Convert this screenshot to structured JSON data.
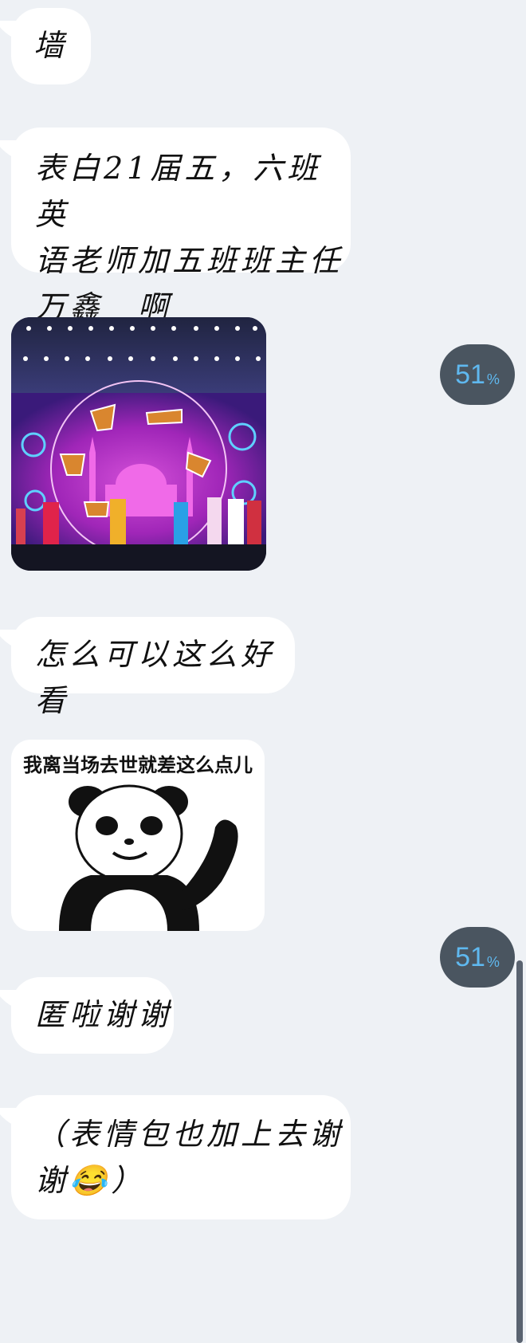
{
  "messages": [
    {
      "text": "墙"
    },
    {
      "text_lines": [
        "表白21届五，六班英",
        "语老师加五班班主任",
        "万鑫　啊"
      ]
    },
    {
      "text": "怎么可以这么好看"
    },
    {
      "text": "匿啦谢谢"
    },
    {
      "text_lines": [
        "（表情包也加上去谢",
        "谢😂）"
      ]
    }
  ],
  "badges": [
    {
      "value": "51",
      "unit": "%"
    },
    {
      "value": "51",
      "unit": "%"
    }
  ],
  "images": {
    "stage_photo": {
      "icon": "stage-performance-photo"
    },
    "meme": {
      "caption": "我离当场去世就差这么点儿",
      "icon": "panda-meme"
    }
  },
  "colors": {
    "background": "#eef1f5",
    "bubble": "#ffffff",
    "badge_bg": "#4a5560",
    "badge_text": "#5fb8ef"
  }
}
